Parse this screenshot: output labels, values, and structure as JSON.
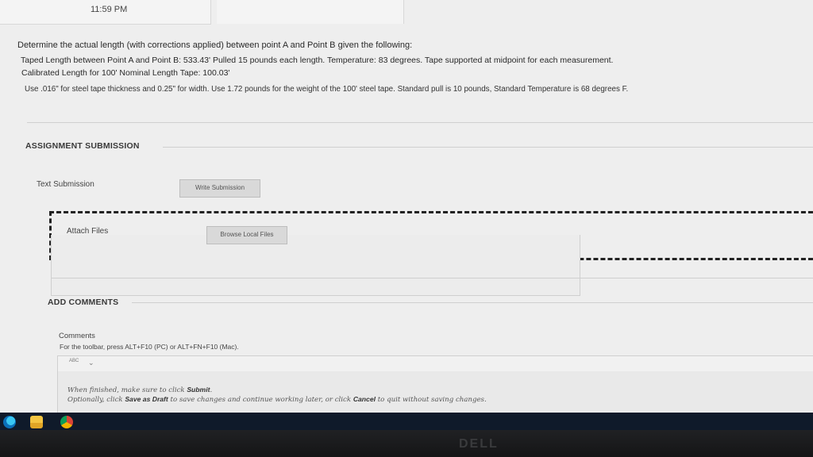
{
  "status": {
    "time": "11:59 PM"
  },
  "question": {
    "line1": "Determine the actual length (with corrections applied) between point A and Point B given the following:",
    "line2": "Taped Length between Point A and Point B: 533.43'  Pulled 15 pounds each length.  Temperature: 83 degrees.  Tape supported at midpoint for each measurement.",
    "line3": "Calibrated Length for 100' Nominal Length Tape: 100.03'",
    "line4": "Use .016\" for steel tape thickness and 0.25\" for width.  Use 1.72 pounds for the weight of the 100' steel tape.  Standard pull is 10 pounds, Standard Temperature is 68 degrees F."
  },
  "assignment": {
    "title": "ASSIGNMENT SUBMISSION",
    "text_label": "Text Submission",
    "write_button": "Write Submission",
    "attach_label": "Attach Files",
    "browse_button": "Browse Local Files"
  },
  "comments": {
    "title": "ADD COMMENTS",
    "label": "Comments",
    "toolbar_hint": "For the toolbar, press ALT+F10 (PC) or ALT+FN+F10 (Mac).",
    "spellcheck_icon": "ABC",
    "hint1_pre": "When finished, make sure to click ",
    "hint1_bold": "Submit",
    "hint1_post": ".",
    "hint2_pre": "Optionally, click ",
    "hint2_bold1": "Save as Draft",
    "hint2_mid": " to save changes and continue working later, or click ",
    "hint2_bold2": "Cancel",
    "hint2_post": " to quit without saving changes."
  },
  "taskbar": {
    "icons": [
      "edge-icon",
      "file-explorer-icon",
      "chrome-icon"
    ]
  },
  "monitor": {
    "brand": "DELL"
  }
}
